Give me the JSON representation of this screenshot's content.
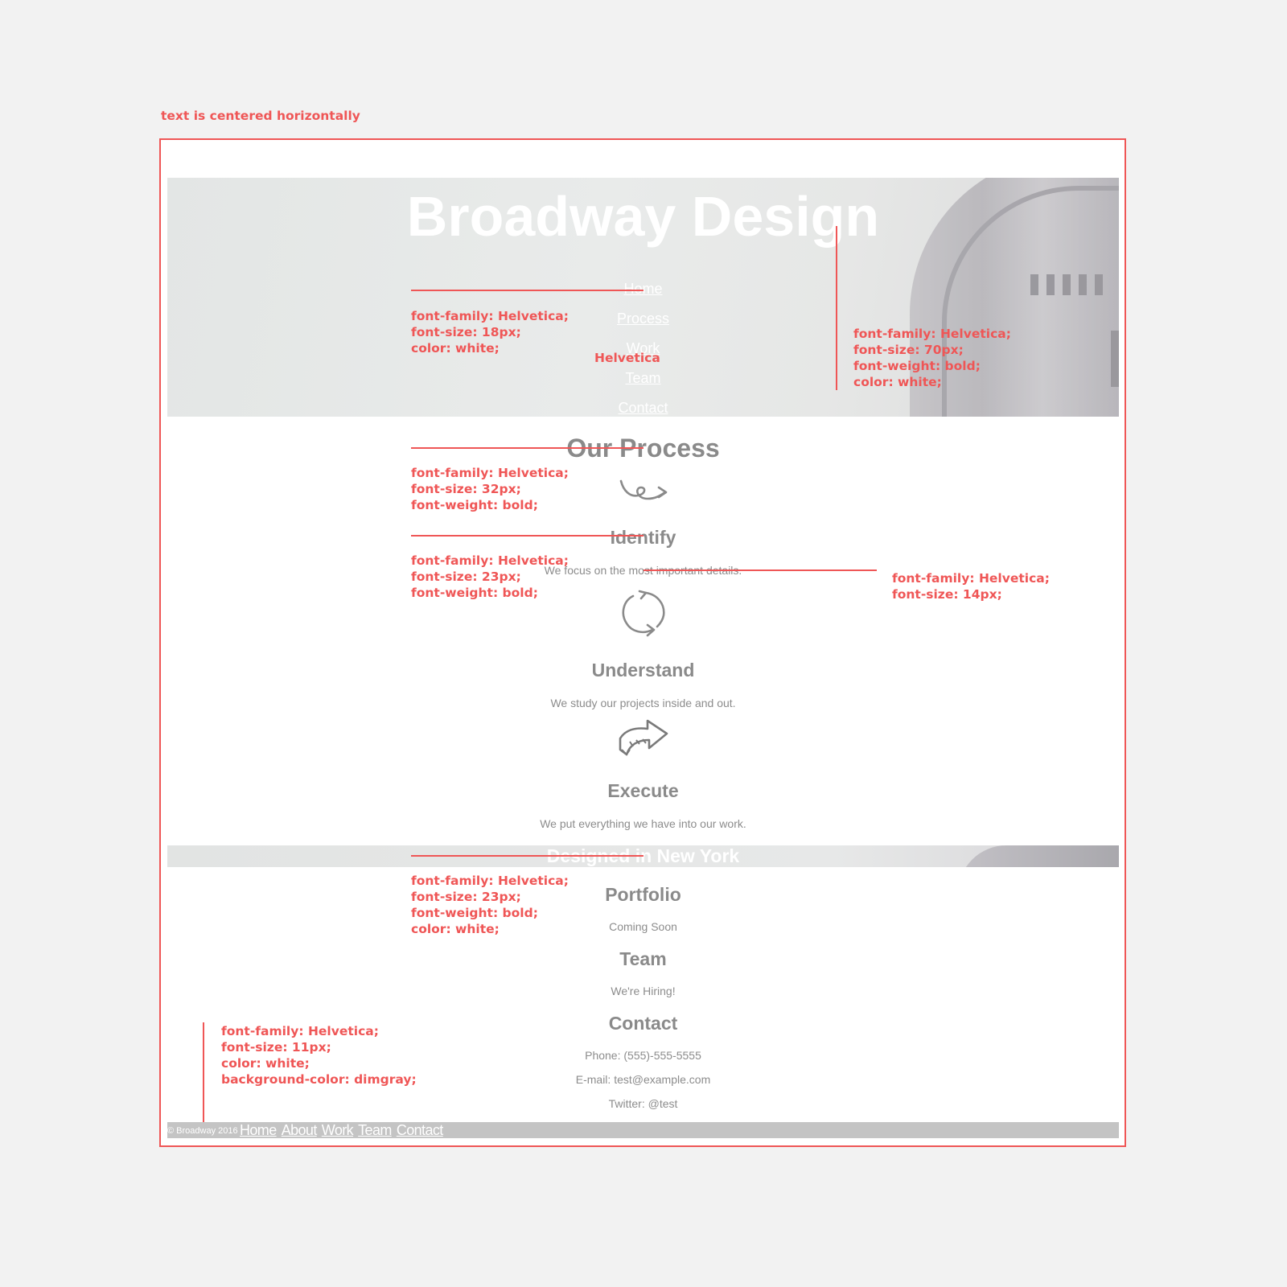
{
  "colors": {
    "annotation": "#ef5656",
    "page_bg": "#f2f2f2",
    "text_gray": "#8a8a8a",
    "footer_bg": "#c4c4c4"
  },
  "annotations": {
    "centered_note": "text is centered horizontally",
    "nav_spec": "font-family: Helvetica;\nfont-size: 18px;\ncolor: white;",
    "nav_font_label": "Helvetica",
    "title_spec": "font-family: Helvetica;\nfont-size: 70px;\nfont-weight: bold;\ncolor: white;",
    "section_spec": "font-family: Helvetica;\nfont-size: 32px;\nfont-weight: bold;",
    "step_heading_spec": "font-family: Helvetica;\nfont-size: 23px;\nfont-weight: bold;",
    "step_text_spec": "font-family: Helvetica;\nfont-size: 14px;",
    "ny_spec": "font-family: Helvetica;\nfont-size: 23px;\nfont-weight: bold;\ncolor: white;",
    "footer_spec": "font-family: Helvetica;\nfont-size: 11px;\ncolor: white;\nbackground-color: dimgray;"
  },
  "hero": {
    "title": "Broadway Design",
    "nav": [
      "Home",
      "Process",
      "Work",
      "Team",
      "Contact"
    ]
  },
  "process": {
    "title": "Our Process",
    "steps": [
      {
        "icon": "squiggle-arrow-icon",
        "title": "Identify",
        "text": "We focus on the most important details."
      },
      {
        "icon": "cycle-arrows-icon",
        "title": "Understand",
        "text": "We study our projects inside and out."
      },
      {
        "icon": "block-arrow-icon",
        "title": "Execute",
        "text": "We put everything we have into our work."
      }
    ]
  },
  "banner": {
    "title": "Designed in New York"
  },
  "portfolio": {
    "title": "Portfolio",
    "text": "Coming Soon"
  },
  "team": {
    "title": "Team",
    "text": "We're Hiring!"
  },
  "contact": {
    "title": "Contact",
    "phone": "Phone: (555)-555-5555",
    "email": "E-mail: test@example.com",
    "twitter": "Twitter: @test"
  },
  "footer": {
    "copyright": "© Broadway 2016",
    "links": [
      "Home",
      "About",
      "Work",
      "Team",
      "Contact"
    ]
  }
}
